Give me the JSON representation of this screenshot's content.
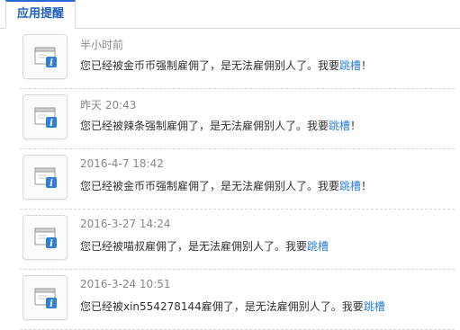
{
  "tabs": [
    {
      "label": "应用提醒"
    }
  ],
  "notifications": [
    {
      "time": "半小时前",
      "text": "您已经被金币币强制雇佣了，是无法雇佣别人了。我要",
      "link": "跳槽",
      "suffix": "！"
    },
    {
      "time": "昨天 20:43",
      "text": "您已经被辣条强制雇佣了，是无法雇佣别人了。我要",
      "link": "跳槽",
      "suffix": "！"
    },
    {
      "time": "2016-4-7 18:42",
      "text": "您已经被金币币强制雇佣了，是无法雇佣别人了。我要",
      "link": "跳槽",
      "suffix": "！"
    },
    {
      "time": "2016-3-27 14:24",
      "text": "您已经被喵叔雇佣了，是无法雇佣别人了。我要",
      "link": "跳槽",
      "suffix": ""
    },
    {
      "time": "2016-3-24 10:51",
      "text": "您已经被xin554278144雇佣了，是无法雇佣别人了。我要",
      "link": "跳槽",
      "suffix": ""
    }
  ],
  "icons": {
    "notification": "app-window-info-icon"
  },
  "colors": {
    "tab_text": "#1f5fbf",
    "tab_top_border": "#2a6ad4",
    "link": "#2f7fd4",
    "time": "#888888",
    "text": "#333333",
    "info_badge": "#2f7fd4"
  }
}
